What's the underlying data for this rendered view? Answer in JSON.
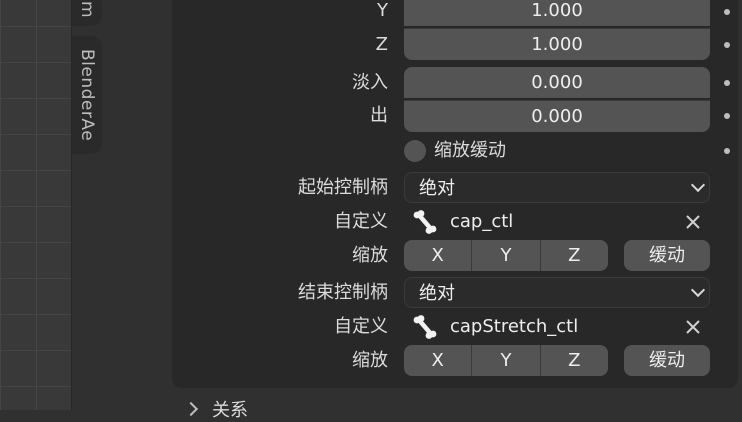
{
  "sidebar_tabs": [
    "m",
    "BlenderAe"
  ],
  "scale_rows": [
    {
      "label": "Y",
      "value": "1.000"
    },
    {
      "label": "Z",
      "value": "1.000"
    }
  ],
  "ease_rows": [
    {
      "label": "淡入",
      "value": "0.000"
    },
    {
      "label": "出",
      "value": "0.000"
    }
  ],
  "scale_ease_checkbox": {
    "label": "缩放缓动",
    "checked": false
  },
  "start_handle": {
    "label": "起始控制柄",
    "mode": "绝对",
    "custom_label": "自定义",
    "bone": "cap_ctl",
    "scale_label": "缩放",
    "axes": [
      "X",
      "Y",
      "Z"
    ],
    "ease_button": "缓动"
  },
  "end_handle": {
    "label": "结束控制柄",
    "mode": "绝对",
    "custom_label": "自定义",
    "bone": "capStretch_ctl",
    "scale_label": "缩放",
    "axes": [
      "X",
      "Y",
      "Z"
    ],
    "ease_button": "缓动"
  },
  "next_section": "关系",
  "icons": [
    "bone-icon",
    "close-icon",
    "chevron-down-icon",
    "chevron-right-icon"
  ],
  "colors": {
    "field": "#545454",
    "subpanel": "#282828",
    "panel": "#303030"
  }
}
